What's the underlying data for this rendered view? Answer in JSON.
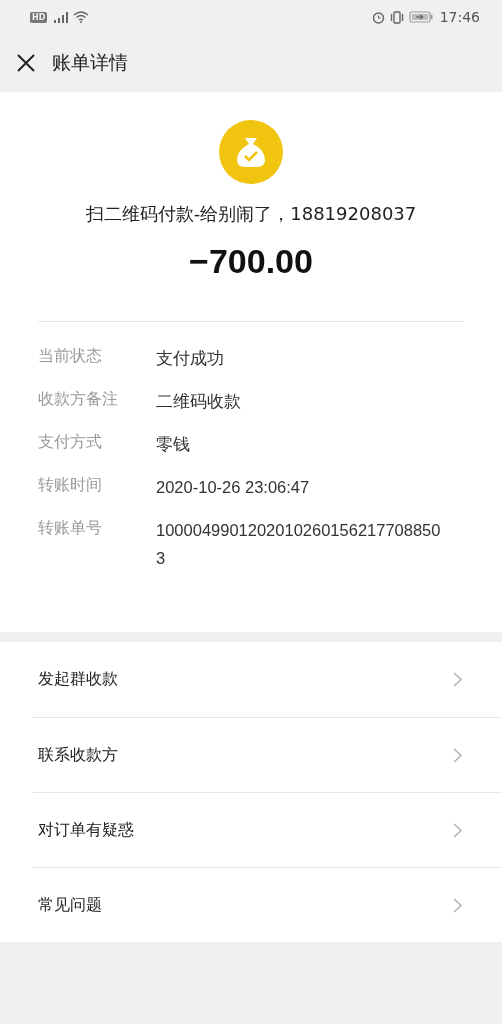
{
  "status_bar": {
    "network_badge": "HD",
    "time": "17:46"
  },
  "header": {
    "title": "账单详情"
  },
  "summary": {
    "merchant": "扫二维码付款-给别闹了，18819208037",
    "amount": "−700.00"
  },
  "details": [
    {
      "label": "当前状态",
      "value": "支付成功"
    },
    {
      "label": "收款方备注",
      "value": "二维码收款"
    },
    {
      "label": "支付方式",
      "value": "零钱"
    },
    {
      "label": "转账时间",
      "value": "2020-10-26 23:06:47"
    },
    {
      "label": "转账单号",
      "value": "10000499012020102601562177088503"
    }
  ],
  "menu": [
    {
      "label": "发起群收款"
    },
    {
      "label": "联系收款方"
    },
    {
      "label": "对订单有疑惑"
    },
    {
      "label": "常见问题"
    }
  ]
}
